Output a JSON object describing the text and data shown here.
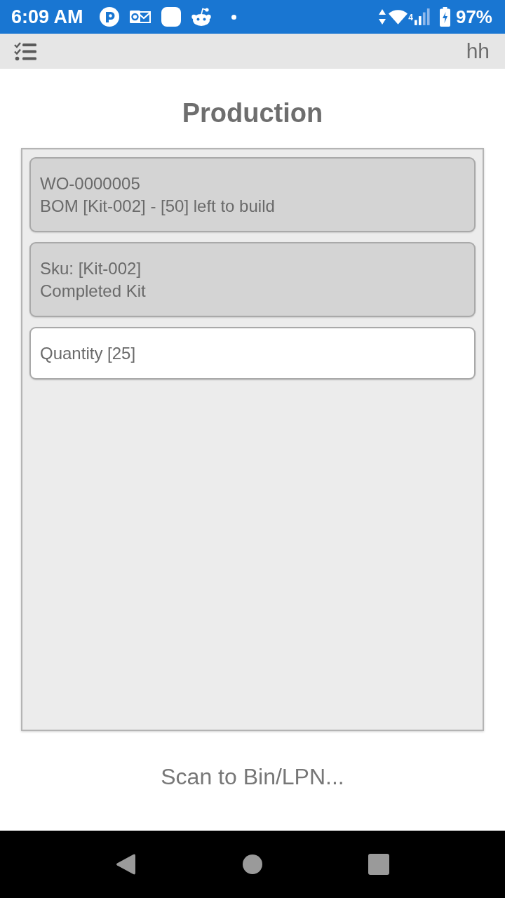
{
  "status_bar": {
    "time": "6:09 AM",
    "network": "4",
    "battery": "97%"
  },
  "app_bar": {
    "user": "hh"
  },
  "title": "Production",
  "cards": [
    {
      "lines": [
        "WO-0000005",
        "BOM [Kit-002] - [50] left to build"
      ],
      "selected": false
    },
    {
      "lines": [
        "Sku: [Kit-002]",
        "Completed Kit"
      ],
      "selected": false
    },
    {
      "lines": [
        "Quantity [25]"
      ],
      "selected": true
    }
  ],
  "scan_field": {
    "placeholder": "Scan to Bin/LPN..."
  }
}
